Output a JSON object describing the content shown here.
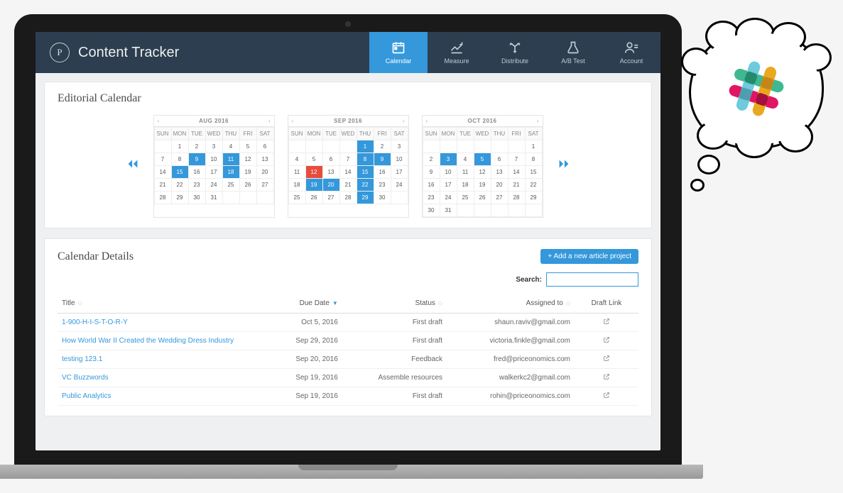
{
  "header": {
    "logo_letter": "P",
    "title": "Content Tracker",
    "nav": [
      {
        "label": "Calendar",
        "active": true
      },
      {
        "label": "Measure",
        "active": false
      },
      {
        "label": "Distribute",
        "active": false
      },
      {
        "label": "A/B Test",
        "active": false
      },
      {
        "label": "Account",
        "active": false
      }
    ]
  },
  "editorial": {
    "title": "Editorial Calendar",
    "day_headers": [
      "SUN",
      "MON",
      "TUE",
      "WED",
      "THU",
      "FRI",
      "SAT"
    ],
    "months": [
      {
        "title": "AUG 2016",
        "first_weekday": 1,
        "num_days": 31,
        "highlights_blue": [
          9,
          11,
          15,
          18
        ],
        "highlights_red": []
      },
      {
        "title": "SEP 2016",
        "first_weekday": 4,
        "num_days": 30,
        "highlights_blue": [
          1,
          8,
          9,
          15,
          19,
          20,
          22,
          29
        ],
        "highlights_red": [
          12
        ]
      },
      {
        "title": "OCT 2016",
        "first_weekday": 6,
        "num_days": 31,
        "highlights_blue": [
          3,
          5
        ],
        "highlights_red": []
      }
    ]
  },
  "details": {
    "title": "Calendar Details",
    "add_button": "+ Add a new article project",
    "search_label": "Search:",
    "search_value": "",
    "columns": [
      "Title",
      "Due Date",
      "Status",
      "Assigned to",
      "Draft Link"
    ],
    "sorted_column": "Due Date",
    "rows": [
      {
        "title": "1-900-H-I-S-T-O-R-Y",
        "due": "Oct 5, 2016",
        "status": "First draft",
        "assigned": "shaun.raviv@gmail.com"
      },
      {
        "title": "How World War II Created the Wedding Dress Industry",
        "due": "Sep 29, 2016",
        "status": "First draft",
        "assigned": "victoria.finkle@gmail.com"
      },
      {
        "title": "testing 123.1",
        "due": "Sep 20, 2016",
        "status": "Feedback",
        "assigned": "fred@priceonomics.com"
      },
      {
        "title": "VC Buzzwords",
        "due": "Sep 19, 2016",
        "status": "Assemble resources",
        "assigned": "walkerkc2@gmail.com"
      },
      {
        "title": "Public Analytics",
        "due": "Sep 19, 2016",
        "status": "First draft",
        "assigned": "rohin@priceonomics.com"
      }
    ]
  },
  "icons": {
    "calendar": "calendar-icon",
    "measure": "chart-icon",
    "distribute": "branch-icon",
    "abtest": "flask-icon",
    "account": "user-icon"
  }
}
